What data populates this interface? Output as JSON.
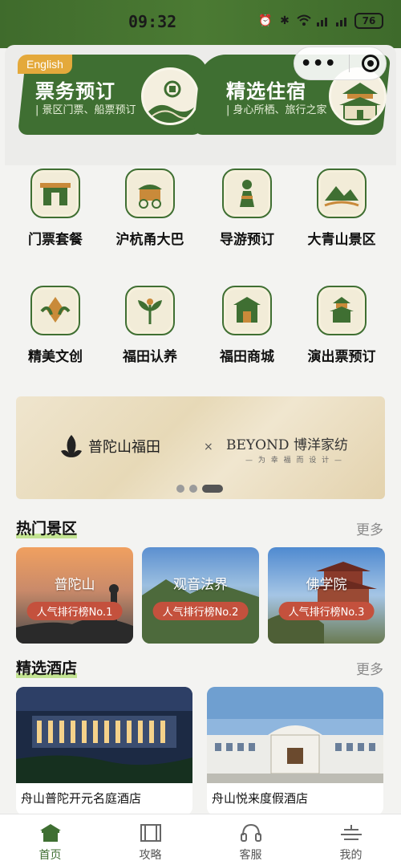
{
  "status": {
    "time": "09:32",
    "battery": "76"
  },
  "top_cards": {
    "ticket": {
      "badge": "English",
      "title": "票务预订",
      "subtitle": "| 景区门票、船票预订"
    },
    "stay": {
      "title": "精选住宿",
      "subtitle": "| 身心所栖、旅行之家"
    }
  },
  "menu": [
    {
      "label": "门票套餐",
      "icon": "gate-icon"
    },
    {
      "label": "沪杭甬大巴",
      "icon": "carriage-icon"
    },
    {
      "label": "导游预订",
      "icon": "guide-icon"
    },
    {
      "label": "大青山景区",
      "icon": "mountain-icon"
    },
    {
      "label": "精美文创",
      "icon": "craft-icon"
    },
    {
      "label": "福田认养",
      "icon": "plant-icon"
    },
    {
      "label": "福田商城",
      "icon": "shop-icon"
    },
    {
      "label": "演出票预订",
      "icon": "pagoda-icon"
    }
  ],
  "banner": {
    "left_text": "普陀山福田",
    "x": "×",
    "right_text": "BEYOND 博洋家纺",
    "right_sub": "— 为 幸 福 而 设 计 —"
  },
  "hot_spots": {
    "title": "热门景区",
    "more": "更多",
    "items": [
      {
        "name": "普陀山",
        "rank": "人气排行榜No.1"
      },
      {
        "name": "观音法界",
        "rank": "人气排行榜No.2"
      },
      {
        "name": "佛学院",
        "rank": "人气排行榜No.3"
      }
    ]
  },
  "hotels": {
    "title": "精选酒店",
    "more": "更多",
    "items": [
      {
        "name": "舟山普陀开元名庭酒店"
      },
      {
        "name": "舟山悦来度假酒店"
      }
    ]
  },
  "tabbar": [
    {
      "label": "首页",
      "icon": "home-icon"
    },
    {
      "label": "攻略",
      "icon": "guide-book-icon"
    },
    {
      "label": "客服",
      "icon": "headset-icon"
    },
    {
      "label": "我的",
      "icon": "profile-icon"
    }
  ],
  "colors": {
    "brand_green": "#3f6f32",
    "accent_gold": "#e4a93b",
    "rank_red": "#c4513d"
  }
}
